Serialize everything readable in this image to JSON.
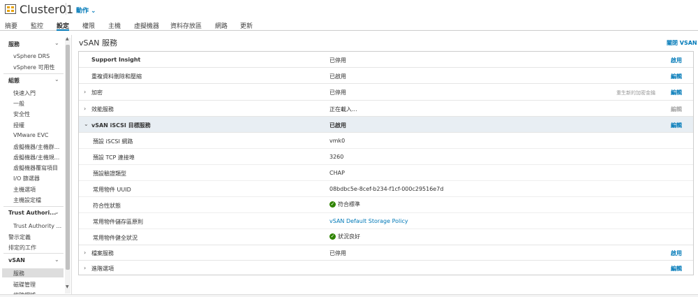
{
  "header": {
    "title": "Cluster01",
    "actions_label": "動作"
  },
  "tabs": [
    "摘要",
    "監控",
    "設定",
    "權限",
    "主機",
    "虛擬機器",
    "資料存放區",
    "網路",
    "更新"
  ],
  "active_tab": "設定",
  "sidebar": {
    "groups": [
      {
        "label": "服務",
        "items": [
          "vSphere DRS",
          "vSphere 可用性"
        ]
      },
      {
        "label": "組態",
        "items": [
          "快速入門",
          "一般",
          "安全性",
          "授權",
          "VMware EVC",
          "虛擬機器/主機群...",
          "虛擬機器/主機規...",
          "虛擬機器覆寫項目",
          "I/O 篩選器",
          "主機選項",
          "主機設定檔"
        ]
      },
      {
        "label": "Trust Authori...",
        "items": [
          "Trust Authority ..."
        ]
      },
      {
        "label_plain": [
          "警示定義",
          "排定的工作"
        ]
      },
      {
        "label": "vSAN",
        "items": [
          "服務",
          "磁碟管理",
          "故障網域"
        ]
      }
    ],
    "selected": "服務"
  },
  "main": {
    "title": "vSAN 服務",
    "close_label": "關閉 VSAN",
    "rows": [
      {
        "name": "Support Insight",
        "status": "已停用",
        "action": "啟用",
        "bold": true,
        "expandable": false
      },
      {
        "name": "重複資料刪除和壓縮",
        "status": "已啟用",
        "action": "編輯",
        "bold": false,
        "expandable": false
      },
      {
        "name": "加密",
        "status": "已停用",
        "hint": "重生新的加密金鑰",
        "action": "編輯",
        "bold": false,
        "expandable": true
      },
      {
        "name": "效能服務",
        "status": "正在載入...",
        "action": "編輯",
        "action_disabled": true,
        "bold": false,
        "expandable": true
      },
      {
        "name": "vSAN iSCSI 目標服務",
        "status": "已啟用",
        "action": "編輯",
        "bold": true,
        "expandable": true,
        "expanded": true
      }
    ],
    "iscsi_details": [
      {
        "label": "預設 iSCSI 網路",
        "value": "vmk0"
      },
      {
        "label": "預設 TCP 連接埠",
        "value": "3260"
      },
      {
        "label": "預設驗證類型",
        "value": "CHAP"
      },
      {
        "label": "常用物件 UUID",
        "value": "08bdbc5e-8cef-b234-f1cf-000c29516e7d"
      },
      {
        "label": "符合性狀態",
        "value": "符合標準",
        "icon": "check"
      },
      {
        "label": "常用物件儲存區原則",
        "value": "vSAN Default Storage Policy",
        "link": true
      },
      {
        "label": "常用物件健全狀況",
        "value": "狀況良好",
        "icon": "check"
      }
    ],
    "bottom_rows": [
      {
        "name": "檔案服務",
        "status": "已停用",
        "action": "啟用"
      },
      {
        "name": "進階選項",
        "status": "",
        "action": "編輯"
      }
    ]
  },
  "colors": {
    "accent": "#0079b8",
    "ok": "#2f8400",
    "highlight": "#e8eef3"
  }
}
